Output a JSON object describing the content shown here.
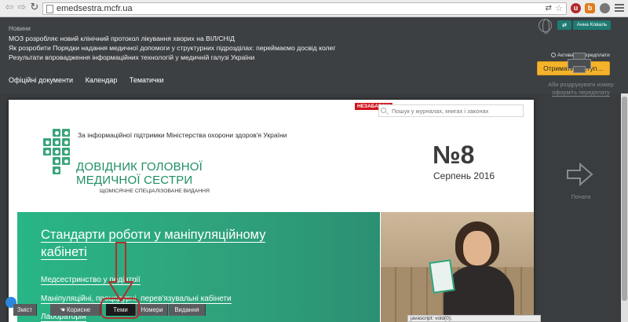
{
  "browser": {
    "url": "emedsestra.mcfr.ua",
    "nav_back_icon": "⇦",
    "nav_forward_icon": "⇨",
    "reload_icon": "↻",
    "translate_icon": "⇄",
    "star_icon": "☆",
    "ext_1_label": "u",
    "ext_2_label": "b",
    "status_text": "javascript: void(0);"
  },
  "header": {
    "news_label": "Новини",
    "news_items": [
      "МОЗ розробляє новий клінічний протокол лікування хворих на ВІЛ/СНІД",
      "Як розробити Порядки надання медичної допомоги у структурних підрозділах: переймаємо досвід колег",
      "Результати впровадження інформаційних технологій у медичній галузі України"
    ],
    "nav_items": [
      "Офіційні документи",
      "Календар",
      "Тематички"
    ],
    "login_icon_label": "⇄",
    "user_name": "Анна Коваль",
    "activation_label": "Активація передплати",
    "get_access_label": "Отримати доступ…"
  },
  "magazine": {
    "badge_new": "НЕЗАБАРОМ",
    "search_placeholder": "Пошук у журналах, книгах і законах",
    "support_text": "За інформаційної підтримки Міністерства охорони здоров'я України",
    "logo_line1": "ДОВІДНИК ГОЛОВНОЇ",
    "logo_line2": "МЕДИЧНОЇ СЕСТРИ",
    "logo_subtitle": "ЩОМІСЯЧНЕ СПЕЦІАЛІЗОВАНЕ ВИДАННЯ",
    "issue_number": "№8",
    "issue_date": "Серпень 2016",
    "banner_title": "Стандарти роботи у маніпуляційному кабінеті",
    "banner_links": [
      "Медсестринство у педіатрії",
      "Маніпуляційні, процедурні, перев'язувальні кабінети",
      "Лабораторія"
    ]
  },
  "sidebar": {
    "print_text_1": "Аби роздрукувати номер",
    "print_link": "оформіть передплату",
    "next_caption": "Почати"
  },
  "toolbar": {
    "contents": "Зміст",
    "useful": "Корисне",
    "topics": "Теми",
    "issues": "Номери",
    "editions": "Видання"
  },
  "colors": {
    "accent_green": "#2fa27c",
    "brand_green": "#1f8f62",
    "header_bg": "#3d4043",
    "get_access_bg": "#f4b32a",
    "annotation_red": "#b0302c"
  }
}
